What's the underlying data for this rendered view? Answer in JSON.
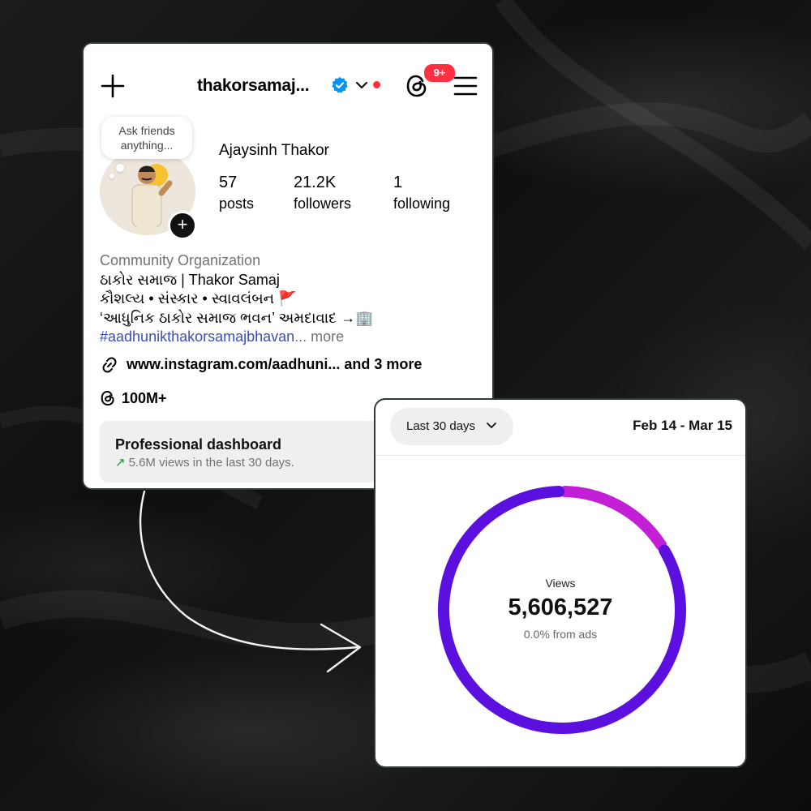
{
  "profile": {
    "username": "thakorsamaj...",
    "notification_badge": "9+",
    "note_text": "Ask friends anything...",
    "full_name": "Ajaysinh Thakor",
    "stats": [
      {
        "value": "57",
        "label": "posts"
      },
      {
        "value": "21.2K",
        "label": "followers"
      },
      {
        "value": "1",
        "label": "following"
      }
    ],
    "category": "Community Organization",
    "bio_lines": [
      "ઠાકોર સમાજ | Thakor Samaj",
      "કૌશલ્ય • સંસ્કાર • સ્વાવલંબન 🚩",
      "‘આધુનિક ઠાકોર સમાજ ભવન’ અમદાવાદ →🏢"
    ],
    "hashtag": "#aadhunikthakorsamajbhavan",
    "more_label": "... more",
    "link_text": "www.instagram.com/aadhuni...  and 3 more",
    "threads_count": "100M+",
    "dashboard_title": "Professional dashboard",
    "dashboard_subtitle": "5.6M views in the last 30 days."
  },
  "insights": {
    "range_label": "Last 30 days",
    "date_range": "Feb 14 - Mar 15",
    "center_label": "Views",
    "center_value": "5,606,527",
    "center_sub": "0.0% from ads"
  },
  "chart_data": {
    "type": "pie",
    "donut": true,
    "series": [
      {
        "value": 0.838,
        "color": "#5b10e0"
      },
      {
        "value": 0.162,
        "color": "#c21fd6"
      }
    ]
  },
  "colors": {
    "accent_blue": "#0095f6",
    "badge_red": "#ff3040",
    "trend_green": "#1a9a3a",
    "donut_purple": "#5b10e0",
    "donut_magenta": "#c21fd6"
  },
  "icons": [
    "plus-icon",
    "verified-icon",
    "chevron-down-icon",
    "threads-icon",
    "menu-icon",
    "link-icon",
    "trend-up-icon"
  ]
}
